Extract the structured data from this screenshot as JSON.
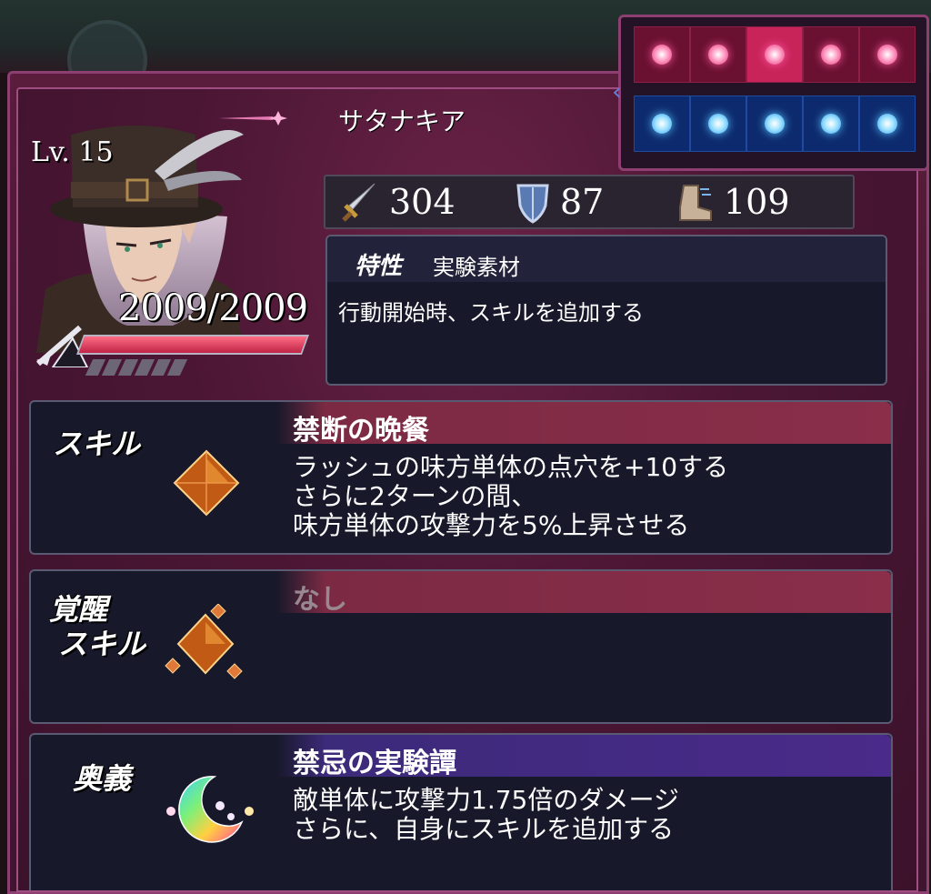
{
  "slots": {
    "top_row": [
      "pink",
      "pink",
      "pink-highlighted",
      "pink",
      "pink"
    ],
    "bottom_row": [
      "blue",
      "blue",
      "blue",
      "blue",
      "blue"
    ]
  },
  "character": {
    "level": "Lv. 15",
    "hp": "2009/2009",
    "hp_ratio": 1.0,
    "name": "サタナキア",
    "weapon_icon": "rifle-icon"
  },
  "stats": {
    "attack": "304",
    "defense": "87",
    "speed": "109"
  },
  "trait": {
    "label": "特性",
    "name": "実験素材",
    "description": "行動開始時、スキルを追加する"
  },
  "skill": {
    "label": "スキル",
    "title": "禁断の晩餐",
    "description": "ラッシュの味方単体の点穴を+10する\nさらに2ターンの間、\n味方単体の攻撃力を5%上昇させる"
  },
  "awakened_skill": {
    "label_line1": "覚醒",
    "label_line2": "スキル",
    "title": "なし"
  },
  "ultimate": {
    "label": "奥義",
    "title": "禁忌の実験譚",
    "description": "敵単体に攻撃力1.75倍のダメージ\nさらに、自身にスキルを追加する"
  },
  "colors": {
    "frame": "#5a1d3c",
    "hp_fill": "#c02446",
    "skill_header": "#8a2e4a",
    "ultimate_header": "#4a2a8a"
  }
}
